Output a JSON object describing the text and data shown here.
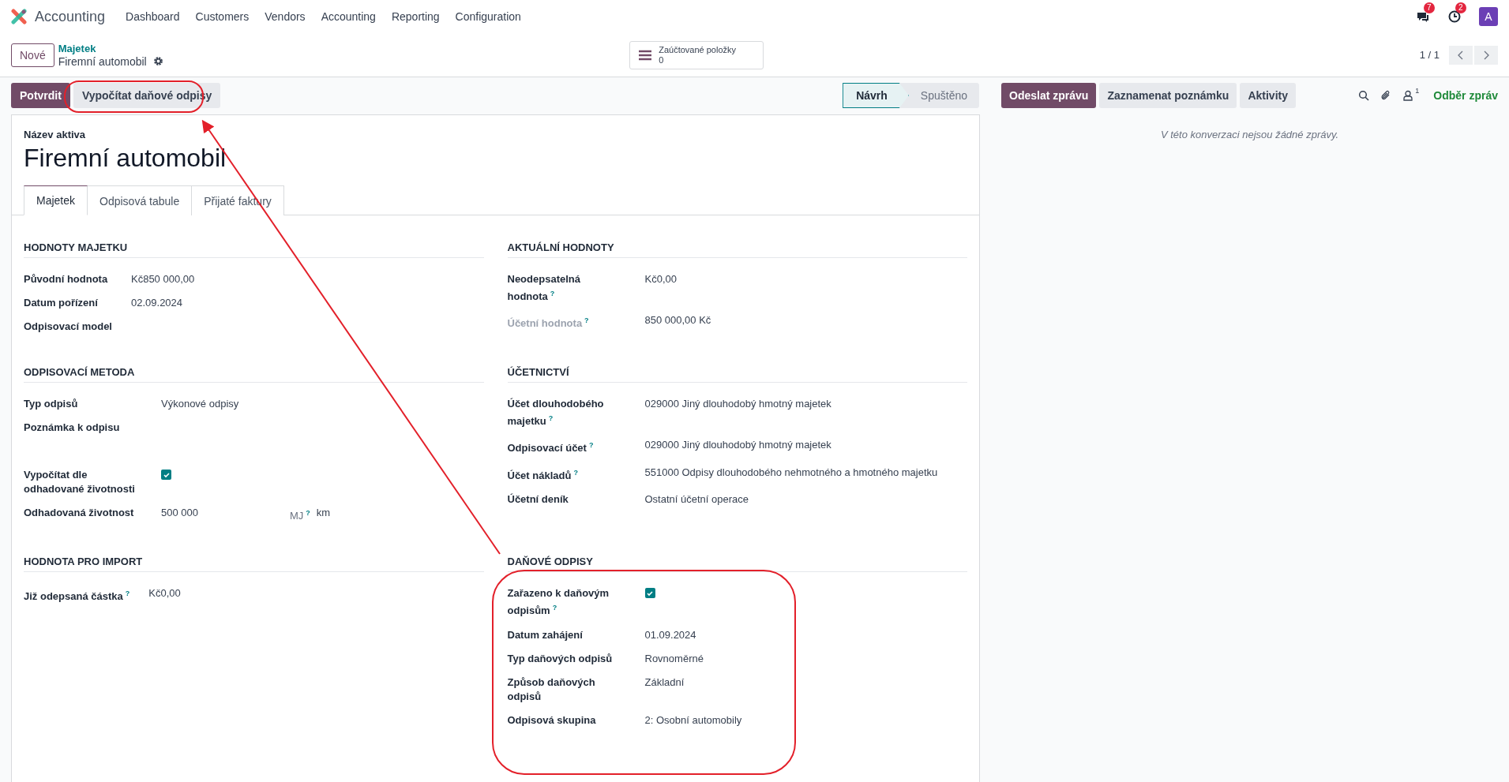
{
  "navbar": {
    "app_name": "Accounting",
    "menu": [
      "Dashboard",
      "Customers",
      "Vendors",
      "Accounting",
      "Reporting",
      "Configuration"
    ],
    "messages_badge": "7",
    "activities_badge": "2",
    "avatar": "A"
  },
  "control_panel": {
    "new_button": "Nové",
    "breadcrumb": "Majetek",
    "record": "Firemní automobil",
    "smart_button": {
      "label": "Zaúčtované položky",
      "count": "0"
    },
    "pager": "1 / 1"
  },
  "actions": [
    {
      "label": "Potvrdit",
      "kind": "primary"
    },
    {
      "label": "Vypočítat daňové odpisy",
      "kind": "secondary"
    }
  ],
  "status_stages": [
    {
      "label": "Návrh",
      "selected": true
    },
    {
      "label": "Spuštěno",
      "selected": false
    }
  ],
  "form": {
    "name_label": "Název aktiva",
    "name": "Firemní automobil",
    "tabs": [
      {
        "label": "Majetek",
        "selected": true
      },
      {
        "label": "Odpisová tabule",
        "selected": false
      },
      {
        "label": "Přijaté faktury",
        "selected": false
      }
    ],
    "sections": [
      {
        "title": "HODNOTY MAJETKU",
        "fields": [
          {
            "kind": "text",
            "label": "Původní hodnota",
            "value": "Kč850 000,00"
          },
          {
            "kind": "text",
            "label": "Datum pořízení",
            "value": "02.09.2024"
          },
          {
            "kind": "text",
            "label": "Odpisovací model"
          }
        ]
      },
      {
        "title": "AKTUÁLNÍ HODNOTY",
        "fields": [
          {
            "kind": "text",
            "label": "Neodepsatelná hodnota",
            "help": "?",
            "value": "Kč0,00"
          },
          {
            "kind": "text",
            "label": "Účetní hodnota",
            "help": "?",
            "muted": true,
            "value": "850 000,00 Kč"
          }
        ]
      },
      {
        "title": "ODPISOVACÍ METODA",
        "fields": [
          {
            "kind": "text",
            "label": "Typ odpisů",
            "value": "Výkonové odpisy"
          },
          {
            "kind": "note",
            "label": "Poznámka k odpisu"
          },
          {
            "kind": "checkbox",
            "label": "Vypočítat dle odhadované životnosti",
            "checked": true
          },
          {
            "kind": "measure",
            "label": "Odhadovaná životnost",
            "value": "500 000",
            "unit_label": "MJ",
            "unit_help": "?",
            "unit": "km"
          }
        ]
      },
      {
        "title": "ÚČETNICTVÍ",
        "fields": [
          {
            "kind": "text",
            "label": "Účet dlouhodobého majetku",
            "help": "?",
            "value": "029000 Jiný dlouhodobý hmotný majetek"
          },
          {
            "kind": "text",
            "label": "Odpisovací účet",
            "help": "?",
            "value": "029000 Jiný dlouhodobý hmotný majetek"
          },
          {
            "kind": "text",
            "label": "Účet nákladů",
            "help": "?",
            "value": "551000 Odpisy dlouhodobého nehmotného a hmotného majetku"
          },
          {
            "kind": "text",
            "label": "Účetní deník",
            "value": "Ostatní účetní operace"
          }
        ]
      },
      {
        "title": "HODNOTA PRO IMPORT",
        "fields": [
          {
            "kind": "text",
            "label": "Již odepsaná částka",
            "help": "?",
            "value": "Kč0,00"
          }
        ]
      },
      {
        "title": "DAŇOVÉ ODPISY",
        "fields": [
          {
            "kind": "checkbox",
            "label": "Zařazeno k daňovým odpisům",
            "help": "?",
            "checked": true
          },
          {
            "kind": "text",
            "label": "Datum zahájení",
            "value": "01.09.2024"
          },
          {
            "kind": "text",
            "label": "Typ daňových odpisů",
            "value": "Rovnoměrné"
          },
          {
            "kind": "text",
            "label": "Způsob daňových odpisů",
            "value": "Základní"
          },
          {
            "kind": "text",
            "label": "Odpisová skupina",
            "value": "2: Osobní automobily"
          }
        ]
      }
    ]
  },
  "chatter": {
    "buttons": [
      {
        "label": "Odeslat zprávu",
        "selected": true
      },
      {
        "label": "Zaznamenat poznámku",
        "selected": false
      },
      {
        "label": "Aktivity",
        "selected": false
      }
    ],
    "followers_count": "1",
    "follow": "Odběr zpráv",
    "empty_message": "V této konverzaci nejsou žádné zprávy."
  }
}
